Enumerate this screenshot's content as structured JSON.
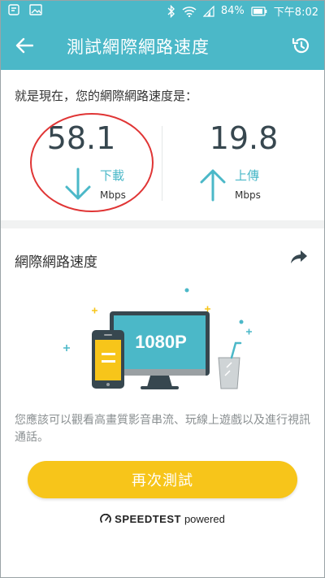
{
  "status_bar": {
    "battery": "84%",
    "time": "下午8:02"
  },
  "app_bar": {
    "title": "測試網際網路速度"
  },
  "result": {
    "intro": "就是現在，您的網際網路速度是：",
    "download": {
      "value": "58.1",
      "label": "下載",
      "unit": "Mbps"
    },
    "upload": {
      "value": "19.8",
      "label": "上傳",
      "unit": "Mbps"
    }
  },
  "card": {
    "title": "網際網路速度",
    "illustration_tv_text": "1080P",
    "description": "您應該可以觀看高畫質影音串流、玩線上遊戲以及進行視訊通話。"
  },
  "actions": {
    "retest_label": "再次測試"
  },
  "footer": {
    "brand": "SPEEDTEST",
    "suffix": "powered"
  },
  "colors": {
    "accent": "#4bb8c8",
    "button": "#f7c51a",
    "highlight_circle": "#e03535"
  }
}
